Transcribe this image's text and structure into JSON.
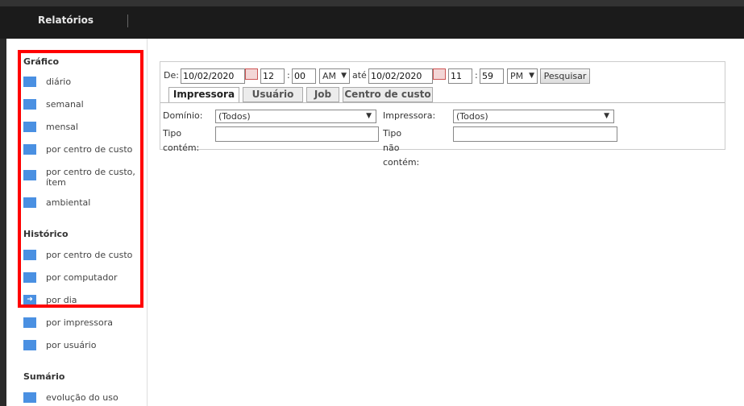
{
  "header": {
    "active_tab": "Relatórios"
  },
  "sidebar": {
    "grafico": {
      "title": "Gráfico",
      "items": [
        "diário",
        "semanal",
        "mensal",
        "por centro de custo",
        "por centro de custo, ítem",
        "ambiental"
      ]
    },
    "historico": {
      "title": "Histórico",
      "items": [
        "por centro de custo",
        "por computador",
        "por dia",
        "por impressora",
        "por usuário"
      ]
    },
    "sumario": {
      "title": "Sumário",
      "items": [
        "evolução do uso"
      ]
    },
    "highlight_color": "#ff0000",
    "item_icon_color": "#4a90e2"
  },
  "filters": {
    "de_label": "De:",
    "from_date": "10/02/2020",
    "from_hour": "12",
    "time_sep": ":",
    "from_min": "00",
    "from_ampm": "AM",
    "ate_label": "até",
    "to_date": "10/02/2020",
    "to_hour": "11",
    "to_min": "59",
    "to_ampm": "PM",
    "search_button": "Pesquisar"
  },
  "tabs": [
    "Impressora",
    "Usuário",
    "Job",
    "Centro de custo"
  ],
  "form": {
    "dominio_label": "Domínio:",
    "dominio_value": "(Todos)",
    "impressora_label": "Impressora:",
    "impressora_value": "(Todos)",
    "tipo_contem_label": "Tipo contém:",
    "tipo_nao_contem_label": "Tipo não contém:"
  }
}
